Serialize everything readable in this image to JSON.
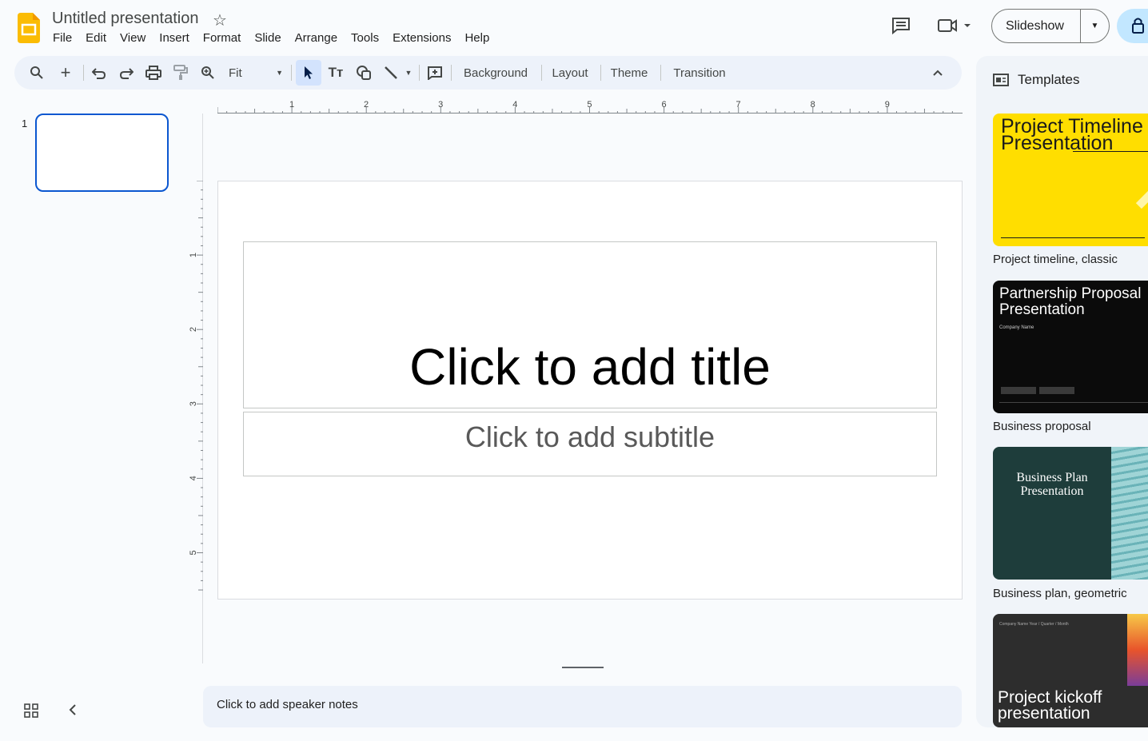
{
  "app": {
    "title": "Untitled presentation"
  },
  "menu": [
    "File",
    "Edit",
    "View",
    "Insert",
    "Format",
    "Slide",
    "Arrange",
    "Tools",
    "Extensions",
    "Help"
  ],
  "header": {
    "slideshow_label": "Slideshow"
  },
  "toolbar": {
    "zoom_value": "Fit",
    "background_label": "Background",
    "layout_label": "Layout",
    "theme_label": "Theme",
    "transition_label": "Transition"
  },
  "slides": {
    "current_number": "1"
  },
  "ruler": {
    "horizontal": [
      "1",
      "2",
      "3",
      "4",
      "5",
      "6",
      "7",
      "8",
      "9"
    ],
    "vertical": [
      "1",
      "2",
      "3",
      "4",
      "5"
    ]
  },
  "slide": {
    "title_placeholder": "Click to add title",
    "subtitle_placeholder": "Click to add subtitle"
  },
  "notes": {
    "placeholder": "Click to add speaker notes"
  },
  "templates": {
    "heading": "Templates",
    "items": [
      {
        "preview_title": "Project Timeline Presentation",
        "label": "Project timeline, classic"
      },
      {
        "preview_title": "Partnership Proposal Presentation",
        "preview_sub": "Company Name",
        "label": "Business proposal"
      },
      {
        "preview_title": "Business Plan Presentation",
        "label": "Business plan, geometric"
      },
      {
        "preview_title": "Project kickoff presentation",
        "preview_sub": "Company Name Year / Quarter / Month",
        "label": ""
      }
    ]
  },
  "colors": {
    "accent": "#0b57d0",
    "toolbar_bg": "#edf2fa",
    "share_bg": "#c2e7ff",
    "slides_yellow": "#fbbc04"
  }
}
